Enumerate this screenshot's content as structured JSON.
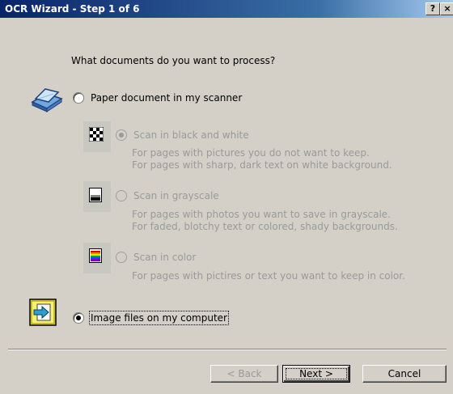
{
  "window": {
    "title": "OCR Wizard - Step 1 of 6",
    "help_glyph": "?",
    "close_glyph": "×"
  },
  "question": "What documents do you want to process?",
  "options": {
    "scanner": {
      "label": "Paper document in my scanner",
      "selected": false
    },
    "bw": {
      "label": "Scan in black and white",
      "desc1": "For pages with pictures you do not want to keep.",
      "desc2": "For pages with sharp, dark text on white background.",
      "selected": true,
      "enabled": false
    },
    "gray": {
      "label": "Scan in grayscale",
      "desc1": "For pages with photos you want to save in grayscale.",
      "desc2": "For faded, blotchy text or colored, shady backgrounds.",
      "selected": false,
      "enabled": false
    },
    "color": {
      "label": "Scan in color",
      "desc1": "For pages with pictires or text you want to keep in color.",
      "selected": false,
      "enabled": false
    },
    "files": {
      "label": "Image files on my computer",
      "selected": true
    }
  },
  "buttons": {
    "back": "< Back",
    "next": "Next >",
    "cancel": "Cancel"
  },
  "icons": {
    "scanner": "scanner-icon",
    "bw": "black-white-checker-icon",
    "gray": "grayscale-icon",
    "color": "color-bars-icon",
    "files": "folder-arrow-icon"
  },
  "colors": {
    "titlebar": "#0a246a",
    "dialog_bg": "#d4d0c8",
    "disabled_text": "#9a9a9a"
  }
}
